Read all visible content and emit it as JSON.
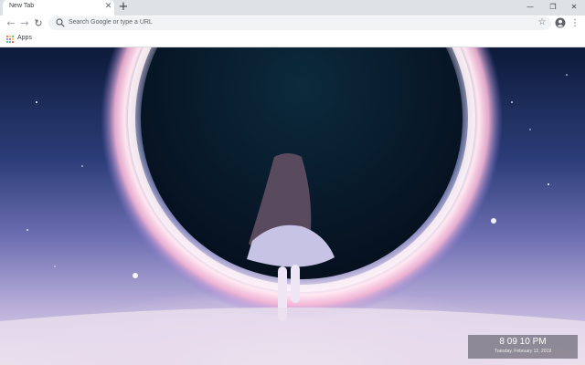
{
  "tab": {
    "title": "New Tab"
  },
  "window_controls": {
    "minimize": "—",
    "maximize": "❐",
    "close": "✕"
  },
  "toolbar": {
    "back": "←",
    "forward": "→",
    "reload": "↻"
  },
  "omnibox": {
    "placeholder": "Search Google or type a URL"
  },
  "bookmarks": {
    "apps_label": "Apps"
  },
  "apps_icon_colors": [
    "#ea4335",
    "#fbbc05",
    "#34a853",
    "#4285f4",
    "#ea4335",
    "#fbbc05",
    "#34a853",
    "#4285f4",
    "#ea4335"
  ],
  "clock": {
    "time": "8 09 10 PM",
    "date": "Tuesday, February 12, 2019"
  },
  "colors": {
    "tabstrip": "#dee1e6",
    "omnibox": "#f1f3f4",
    "ring_glow": "#ffe8f2"
  }
}
